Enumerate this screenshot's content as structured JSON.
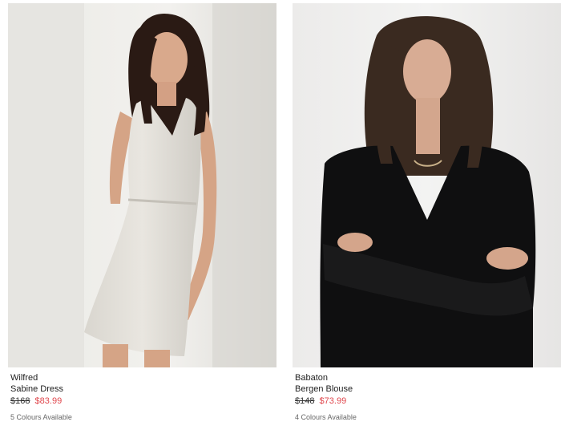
{
  "products": [
    {
      "brand": "Wilfred",
      "name": "Sabine Dress",
      "price_original": "$168",
      "price_sale": "$83.99",
      "colours": "5 Colours Available",
      "image_icon": "product-photo-dress-white"
    },
    {
      "brand": "Babaton",
      "name": "Bergen Blouse",
      "price_original": "$148",
      "price_sale": "$73.99",
      "colours": "4 Colours Available",
      "image_icon": "product-photo-blouse-black"
    }
  ],
  "colors": {
    "sale": "#e0484e",
    "text": "#222222",
    "muted": "#666666"
  }
}
